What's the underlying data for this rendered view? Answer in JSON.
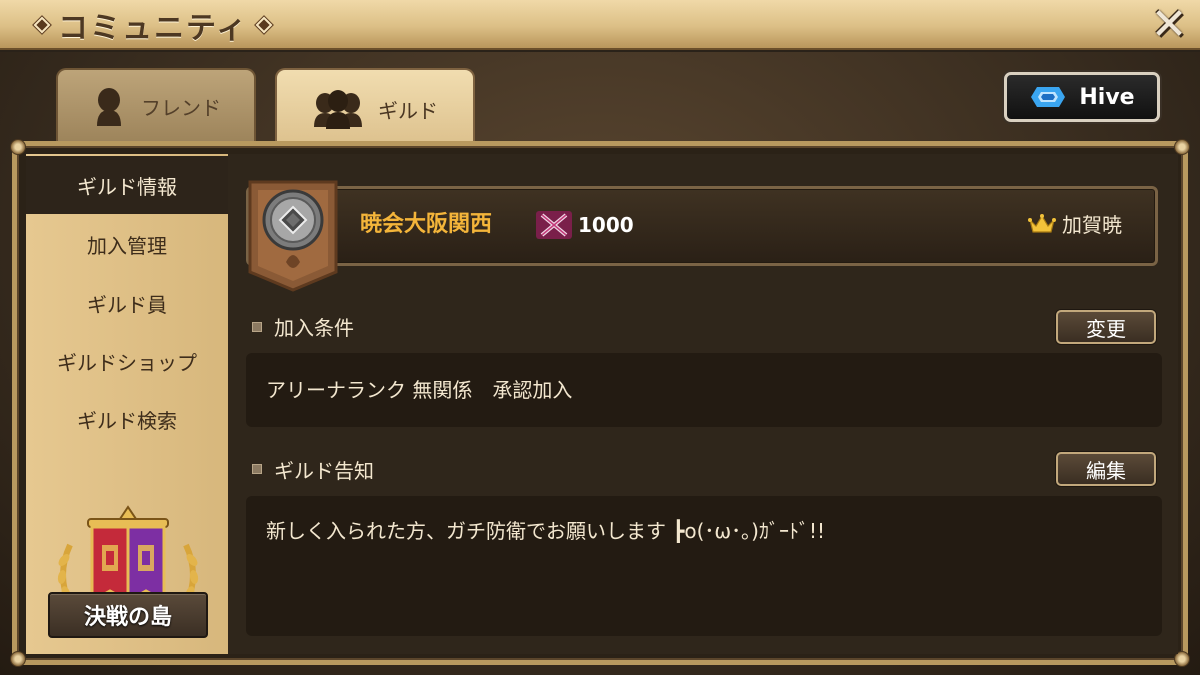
{
  "window": {
    "title": "コミュニティ",
    "close_glyph": "✕"
  },
  "tabs": [
    {
      "label": "フレンド",
      "icon": "person-icon",
      "active": false
    },
    {
      "label": "ギルド",
      "icon": "group-icon",
      "active": true
    }
  ],
  "hive_button": {
    "label": "Hive",
    "icon": "hive-logo-icon"
  },
  "sidebar": {
    "items": [
      {
        "label": "ギルド情報",
        "active": true
      },
      {
        "label": "加入管理",
        "active": false
      },
      {
        "label": "ギルド員",
        "active": false
      },
      {
        "label": "ギルドショップ",
        "active": false
      },
      {
        "label": "ギルド検索",
        "active": false
      }
    ],
    "event_button": {
      "label": "決戦の島",
      "icon": "battle-banner-icon"
    }
  },
  "guild": {
    "name": "暁会大阪関西",
    "points": "1000",
    "points_icon": "crossed-swords-icon",
    "master_icon": "crown-icon",
    "master": "加賀暁",
    "emblem_icon": "guild-emblem-icon"
  },
  "sections": {
    "conditions": {
      "title": "加入条件",
      "button": "変更",
      "text": "アリーナランク 無関係　承認加入"
    },
    "notice": {
      "title": "ギルド告知",
      "button": "編集",
      "text": "新しく入られた方、ガチ防衛でお願いします ┣o(･ω･｡)ｶﾞｰﾄﾞ!!"
    }
  },
  "colors": {
    "accent_gold": "#f4b53a",
    "frame_gold": "#b8995f",
    "panel_dark": "#231b12",
    "sidebar_tan": "#e6c890"
  }
}
